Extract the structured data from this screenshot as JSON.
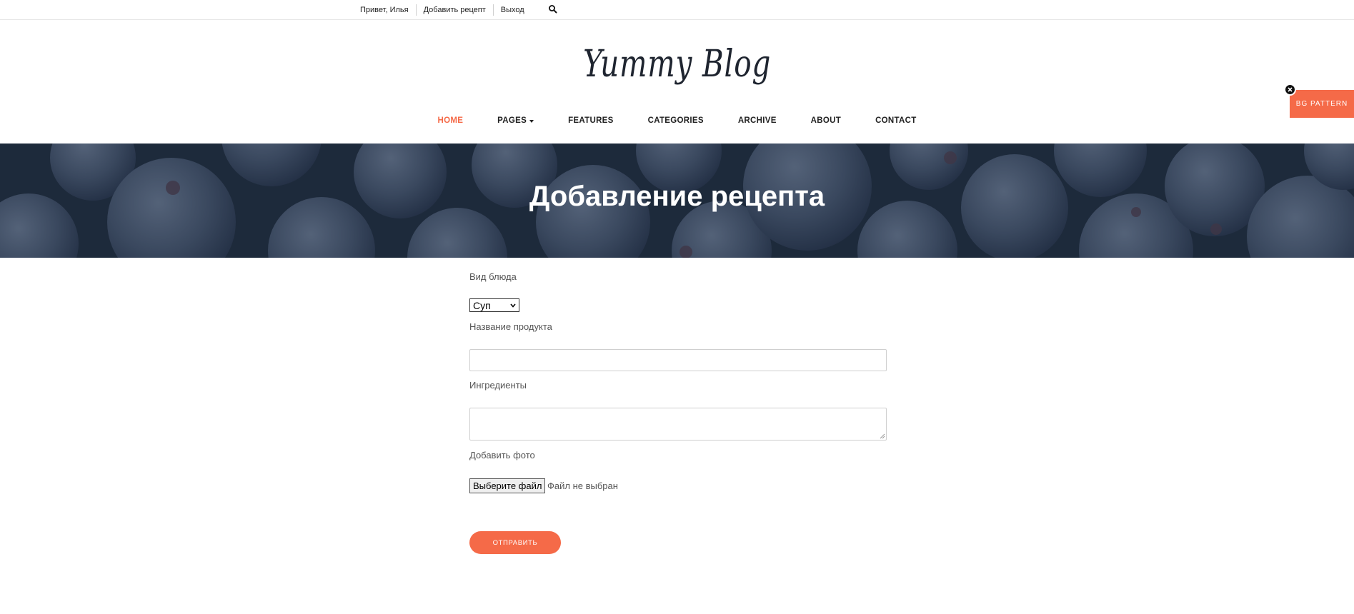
{
  "topbar": {
    "greeting": "Привет, Илья",
    "add_recipe": "Добавить рецепт",
    "logout": "Выход",
    "search_icon": "search-icon"
  },
  "logo": {
    "text": "Yummy Blog"
  },
  "nav": {
    "items": [
      {
        "label": "HOME",
        "active": true
      },
      {
        "label": "PAGES",
        "dropdown": true
      },
      {
        "label": "FEATURES"
      },
      {
        "label": "CATEGORIES"
      },
      {
        "label": "ARCHIVE"
      },
      {
        "label": "ABOUT"
      },
      {
        "label": "CONTACT"
      }
    ]
  },
  "side_tab": {
    "label": "BG PATTERN",
    "close_icon": "close-icon"
  },
  "hero": {
    "title": "Добавление рецепта"
  },
  "form": {
    "dish_type_label": "Вид блюда",
    "dish_type_value": "Суп",
    "product_name_label": "Название продукта",
    "product_name_value": "",
    "ingredients_label": "Ингредиенты",
    "ingredients_value": "",
    "photo_label": "Добавить фото",
    "file_button": "Выберите файл",
    "file_status": "Файл не выбран",
    "submit": "ОТПРАВИТЬ"
  },
  "colors": {
    "accent": "#f56a48",
    "hero_overlay": "#2f3e52",
    "text": "#333333"
  }
}
